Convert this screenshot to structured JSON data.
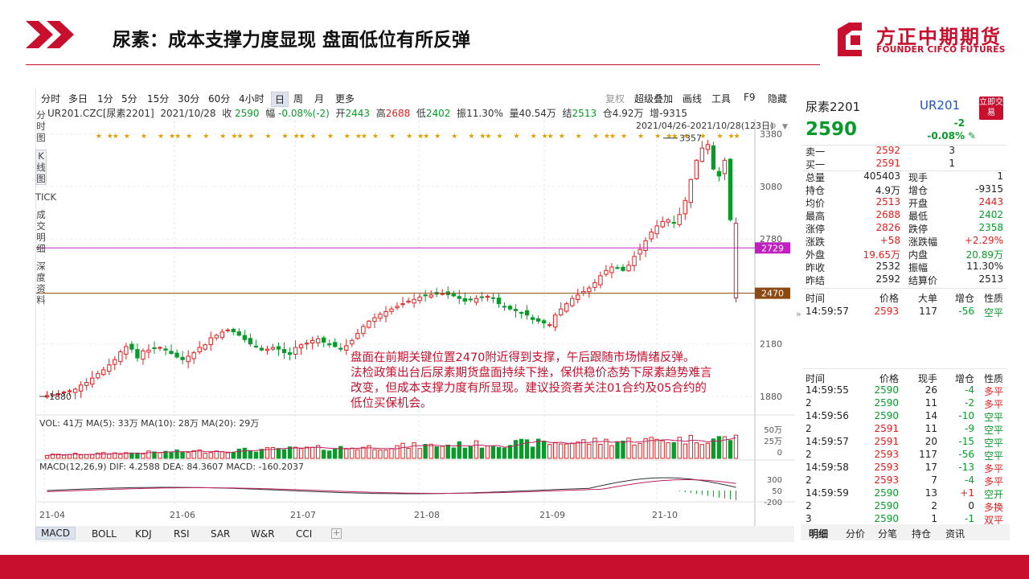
{
  "slide": {
    "title": "尿素：成本支撑力度显现 盘面低位有所反弹",
    "logo_cn": "方正中期期货",
    "logo_en": "FOUNDER CIFCO FUTURES",
    "brand_color": "#c8102e"
  },
  "toolbar": {
    "periods": [
      "分时",
      "多日",
      "1分",
      "5分",
      "15分",
      "30分",
      "60分",
      "4小时",
      "日",
      "周",
      "月",
      "更多"
    ],
    "active_period": "日",
    "right": [
      "复权",
      "超级叠加",
      "画线",
      "工具",
      "F9",
      "隐藏"
    ]
  },
  "sidebar": [
    "分时图",
    "K线图",
    "TICK",
    "成交明细",
    "深度资料"
  ],
  "info_bar": {
    "symbol": "UR201.CZC[尿素2201]",
    "date": "2021/10/28",
    "close_label": "收",
    "close": "2590",
    "change_label": "幅",
    "change": "-0.08%(-2)",
    "open_label": "开",
    "open": "2443",
    "high_label": "高",
    "high": "2688",
    "low_label": "低",
    "low": "2402",
    "amp_label": "振",
    "amp": "11.30%",
    "vol_label": "量",
    "vol": "40.54万",
    "settle_label": "结",
    "settle": "2513",
    "oi_label": "仓",
    "oi": "4.92万",
    "inc_label": "增",
    "inc": "-9315"
  },
  "range_label": "2021/04/26-2021/10/28(123日)",
  "chart_data": {
    "type": "candlestick",
    "y_ticks": [
      "3380",
      "3080",
      "2780",
      "2180",
      "1880"
    ],
    "price_lines": [
      {
        "label": "2729",
        "value": 2729,
        "color": "#c020c0"
      },
      {
        "label": "2470",
        "value": 2470,
        "color": "#8a4a12"
      }
    ],
    "high_mark": "3357",
    "low_mark": "1880",
    "x_ticks": [
      "21-04",
      "21-06",
      "21-07",
      "21-08",
      "21-09",
      "21-10"
    ],
    "closes": [
      1885,
      1890,
      1896,
      1905,
      1912,
      1922,
      1945,
      1960,
      1985,
      2010,
      2032,
      2060,
      2090,
      2135,
      2165,
      2150,
      2100,
      2140,
      2145,
      2155,
      2160,
      2145,
      2125,
      2105,
      2090,
      2110,
      2130,
      2160,
      2175,
      2215,
      2230,
      2248,
      2260,
      2250,
      2230,
      2205,
      2180,
      2165,
      2145,
      2150,
      2160,
      2150,
      2130,
      2120,
      2160,
      2175,
      2185,
      2200,
      2210,
      2190,
      2175,
      2165,
      2150,
      2170,
      2200,
      2240,
      2280,
      2310,
      2330,
      2350,
      2365,
      2380,
      2395,
      2410,
      2425,
      2435,
      2448,
      2455,
      2460,
      2465,
      2468,
      2462,
      2455,
      2440,
      2425,
      2432,
      2440,
      2448,
      2452,
      2440,
      2410,
      2392,
      2380,
      2370,
      2360,
      2345,
      2320,
      2310,
      2300,
      2290,
      2345,
      2380,
      2410,
      2440,
      2460,
      2480,
      2500,
      2530,
      2570,
      2600,
      2620,
      2612,
      2600,
      2630,
      2680,
      2720,
      2770,
      2820,
      2855,
      2880,
      2890,
      2870,
      2920,
      3000,
      3120,
      3230,
      3300,
      3320,
      3180,
      3140,
      3230,
      2890,
      2870
    ],
    "volume_label": "VOL: 41万  MA(5): 33万  MA(10): 28万  MA(20): 29万",
    "volume_axis": [
      "50万",
      "25万",
      "0"
    ],
    "macd_label": "MACD(12,26,9)  DIF: 4.2588  DEA: 84.3607  MACD: -160.2037",
    "macd_axis": [
      "300",
      "50",
      "-200"
    ],
    "note_lines": [
      "盘面在前期关键位置2470附近得到支撑，午后跟随市场情绪反弹。",
      "法检政策出台后尿素期货盘面持续下挫，保供稳价态势下尿素趋势难言",
      "改变，但成本支撑力度有所显现。建议投资者关注01合约及05合约的",
      "低位买保机会。"
    ],
    "up_color": "#e02020",
    "down_color": "#0a9a2b"
  },
  "indicator_tabs": [
    "MACD",
    "BOLL",
    "KDJ",
    "RSI",
    "SAR",
    "W&R",
    "CCI"
  ],
  "quote": {
    "name": "尿素2201",
    "code": "UR201",
    "button": "立即交易",
    "price": "2590",
    "change": "-2",
    "change_pct": "-0.08%",
    "sell1": {
      "label": "卖一",
      "price": "2592",
      "qty": "3"
    },
    "buy1": {
      "label": "买一",
      "price": "2591",
      "qty": "1"
    },
    "stats": [
      [
        "总量",
        "405403",
        "现手",
        "1"
      ],
      [
        "持仓",
        "4.9万",
        "增仓",
        "-9315"
      ],
      [
        "均价",
        "2513",
        "开盘",
        "2443"
      ],
      [
        "最高",
        "2688",
        "最低",
        "2402"
      ],
      [
        "涨停",
        "2826",
        "跌停",
        "2358"
      ],
      [
        "涨跌",
        "+58",
        "涨跌幅",
        "+2.29%"
      ],
      [
        "外盘",
        "19.65万",
        "内盘",
        "20.89万"
      ],
      [
        "昨收",
        "2532",
        "振幅",
        "11.30%"
      ],
      [
        "昨结",
        "2592",
        "结算价",
        "2513"
      ]
    ],
    "last_header": [
      "时间",
      "价格",
      "大单",
      "增仓",
      "性质"
    ],
    "last_row": [
      "14:59:57",
      "2593",
      "117",
      "-56",
      "空平"
    ],
    "tick_header": [
      "时间",
      "价格",
      "现手",
      "增仓",
      "性质"
    ],
    "ticks": [
      [
        "14:59:55",
        "2590",
        "26",
        "-4",
        "多平"
      ],
      [
        "2",
        "2590",
        "11",
        "-2",
        "多平"
      ],
      [
        "14:59:56",
        "2590",
        "14",
        "-10",
        "空平"
      ],
      [
        "2",
        "2591",
        "11",
        "-9",
        "空平"
      ],
      [
        "14:59:57",
        "2591",
        "20",
        "-15",
        "空平"
      ],
      [
        "2",
        "2593",
        "117",
        "-56",
        "空平"
      ],
      [
        "14:59:58",
        "2593",
        "17",
        "-13",
        "多平"
      ],
      [
        "2",
        "2593",
        "7",
        "-4",
        "多平"
      ],
      [
        "14:59:59",
        "2590",
        "13",
        "+1",
        "空开"
      ],
      [
        "2",
        "2590",
        "2",
        "0",
        "多换"
      ],
      [
        "3",
        "2590",
        "1",
        "-1",
        "双平"
      ]
    ],
    "bottom_tabs": [
      "明细",
      "分价",
      "分笔",
      "持仓",
      "资讯"
    ]
  }
}
